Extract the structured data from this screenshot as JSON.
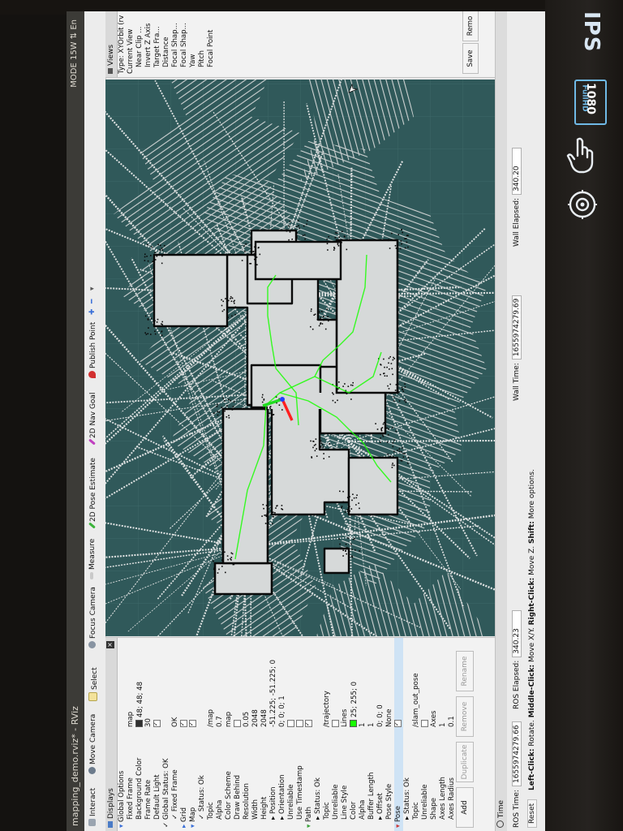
{
  "window": {
    "title": "mapping_demo.rviz* - RViz",
    "system_tray": "MODE 15W  ⇅  En"
  },
  "toolbar": {
    "interact": "Interact",
    "move_camera": "Move Camera",
    "select": "Select",
    "focus_camera": "Focus Camera",
    "measure": "Measure",
    "pose_estimate": "2D Pose Estimate",
    "nav_goal": "2D Nav Goal",
    "publish_point": "Publish Point"
  },
  "displays": {
    "header": "Displays",
    "rows": [
      {
        "indent": 0,
        "label": "Global Options",
        "value": "",
        "marker": "▾",
        "color": "#3a6fd8"
      },
      {
        "indent": 1,
        "label": "Fixed Frame",
        "value": "map"
      },
      {
        "indent": 1,
        "label": "Background Color",
        "value": "48; 48; 48",
        "swatch": "#303030"
      },
      {
        "indent": 1,
        "label": "Frame Rate",
        "value": "30"
      },
      {
        "indent": 1,
        "label": "Default Light",
        "value": "",
        "check": true
      },
      {
        "indent": 0,
        "label": "Global Status: OK",
        "value": "",
        "marker": "✓"
      },
      {
        "indent": 1,
        "label": "Fixed Frame",
        "value": "OK",
        "marker": "✓"
      },
      {
        "indent": 0,
        "label": "Grid",
        "value": "",
        "check": true,
        "marker": "▸",
        "color": "#3a6fd8"
      },
      {
        "indent": 0,
        "label": "Map",
        "value": "",
        "check": true,
        "marker": "▾",
        "color": "#3a6fd8"
      },
      {
        "indent": 1,
        "label": "Status: Ok",
        "value": "",
        "marker": "✓"
      },
      {
        "indent": 1,
        "label": "Topic",
        "value": "/map"
      },
      {
        "indent": 1,
        "label": "Alpha",
        "value": "0.7"
      },
      {
        "indent": 1,
        "label": "Color Scheme",
        "value": "map"
      },
      {
        "indent": 1,
        "label": "Draw Behind",
        "value": "",
        "check": false
      },
      {
        "indent": 1,
        "label": "Resolution",
        "value": "0.05"
      },
      {
        "indent": 1,
        "label": "Width",
        "value": "2048"
      },
      {
        "indent": 1,
        "label": "Height",
        "value": "2048"
      },
      {
        "indent": 1,
        "label": "Position",
        "value": "-51.225; -51.225; 0",
        "marker": "▸"
      },
      {
        "indent": 1,
        "label": "Orientation",
        "value": "0; 0; 0; 1",
        "marker": "▸"
      },
      {
        "indent": 1,
        "label": "Unreliable",
        "value": "",
        "check": false
      },
      {
        "indent": 1,
        "label": "Use Timestamp",
        "value": "",
        "check": false
      },
      {
        "indent": 0,
        "label": "Path",
        "value": "",
        "check": true,
        "marker": "▾",
        "color": "#3aa13a"
      },
      {
        "indent": 1,
        "label": "Status: Ok",
        "value": "",
        "marker": "▸"
      },
      {
        "indent": 1,
        "label": "Topic",
        "value": "/trajectory"
      },
      {
        "indent": 1,
        "label": "Unreliable",
        "value": "",
        "check": false
      },
      {
        "indent": 1,
        "label": "Line Style",
        "value": "Lines"
      },
      {
        "indent": 1,
        "label": "Color",
        "value": "25; 255; 0",
        "swatch": "#19ff00"
      },
      {
        "indent": 1,
        "label": "Alpha",
        "value": "1"
      },
      {
        "indent": 1,
        "label": "Buffer Length",
        "value": "1"
      },
      {
        "indent": 1,
        "label": "Offset",
        "value": "0; 0; 0",
        "marker": "▸"
      },
      {
        "indent": 1,
        "label": "Pose Style",
        "value": "None"
      },
      {
        "indent": 0,
        "label": "Pose",
        "value": "",
        "check": true,
        "marker": "▾",
        "color": "#cc3a3a",
        "selected": true
      },
      {
        "indent": 1,
        "label": "Status: Ok",
        "value": "",
        "marker": "▸"
      },
      {
        "indent": 1,
        "label": "Topic",
        "value": "/slam_out_pose"
      },
      {
        "indent": 1,
        "label": "Unreliable",
        "value": "",
        "check": false
      },
      {
        "indent": 1,
        "label": "Shape",
        "value": "Axes"
      },
      {
        "indent": 1,
        "label": "Axes Length",
        "value": "1"
      },
      {
        "indent": 1,
        "label": "Axes Radius",
        "value": "0.1"
      }
    ],
    "buttons": {
      "add": "Add",
      "duplicate": "Duplicate",
      "remove": "Remove",
      "rename": "Rename"
    }
  },
  "time": {
    "header": "Time",
    "ros_time_label": "ROS Time:",
    "ros_time": "1655974279.66",
    "ros_elapsed_label": "ROS Elapsed:",
    "ros_elapsed": "340.23",
    "wall_time_label": "Wall Time:",
    "wall_time": "1655974279.69",
    "wall_elapsed_label": "Wall Elapsed:",
    "wall_elapsed": "340.20",
    "reset": "Reset",
    "hint_l_key": "Left-Click:",
    "hint_l": "Rotate.",
    "hint_m_key": "Middle-Click:",
    "hint_m": "Move X/Y.",
    "hint_r_key": "Right-Click:",
    "hint_r": "Move Z.",
    "hint_s_key": "Shift:",
    "hint_s": "More options."
  },
  "views": {
    "header": "Views",
    "type_label": "Type:",
    "type_value": "XYOrbit (rv",
    "items": [
      "Current View",
      "Near Clip ...",
      "Invert Z Axis",
      "Target Fra...",
      "Distance",
      "Focal Shap...",
      "Focal Shap...",
      "Yaw",
      "Pitch",
      "Focal Point"
    ],
    "save": "Save",
    "remove": "Remo"
  },
  "bezel": {
    "brand": "IPS",
    "badge_top": "FullHD",
    "badge_bottom": "1080"
  },
  "colors": {
    "viewport": "#30595a",
    "free_space": "#d6d9d9",
    "obstacle": "#0a0a0a",
    "trajectory": "#19ff00",
    "pose_x": "#ff2020",
    "pose_y": "#20dd20",
    "pose_z": "#2040ff"
  }
}
